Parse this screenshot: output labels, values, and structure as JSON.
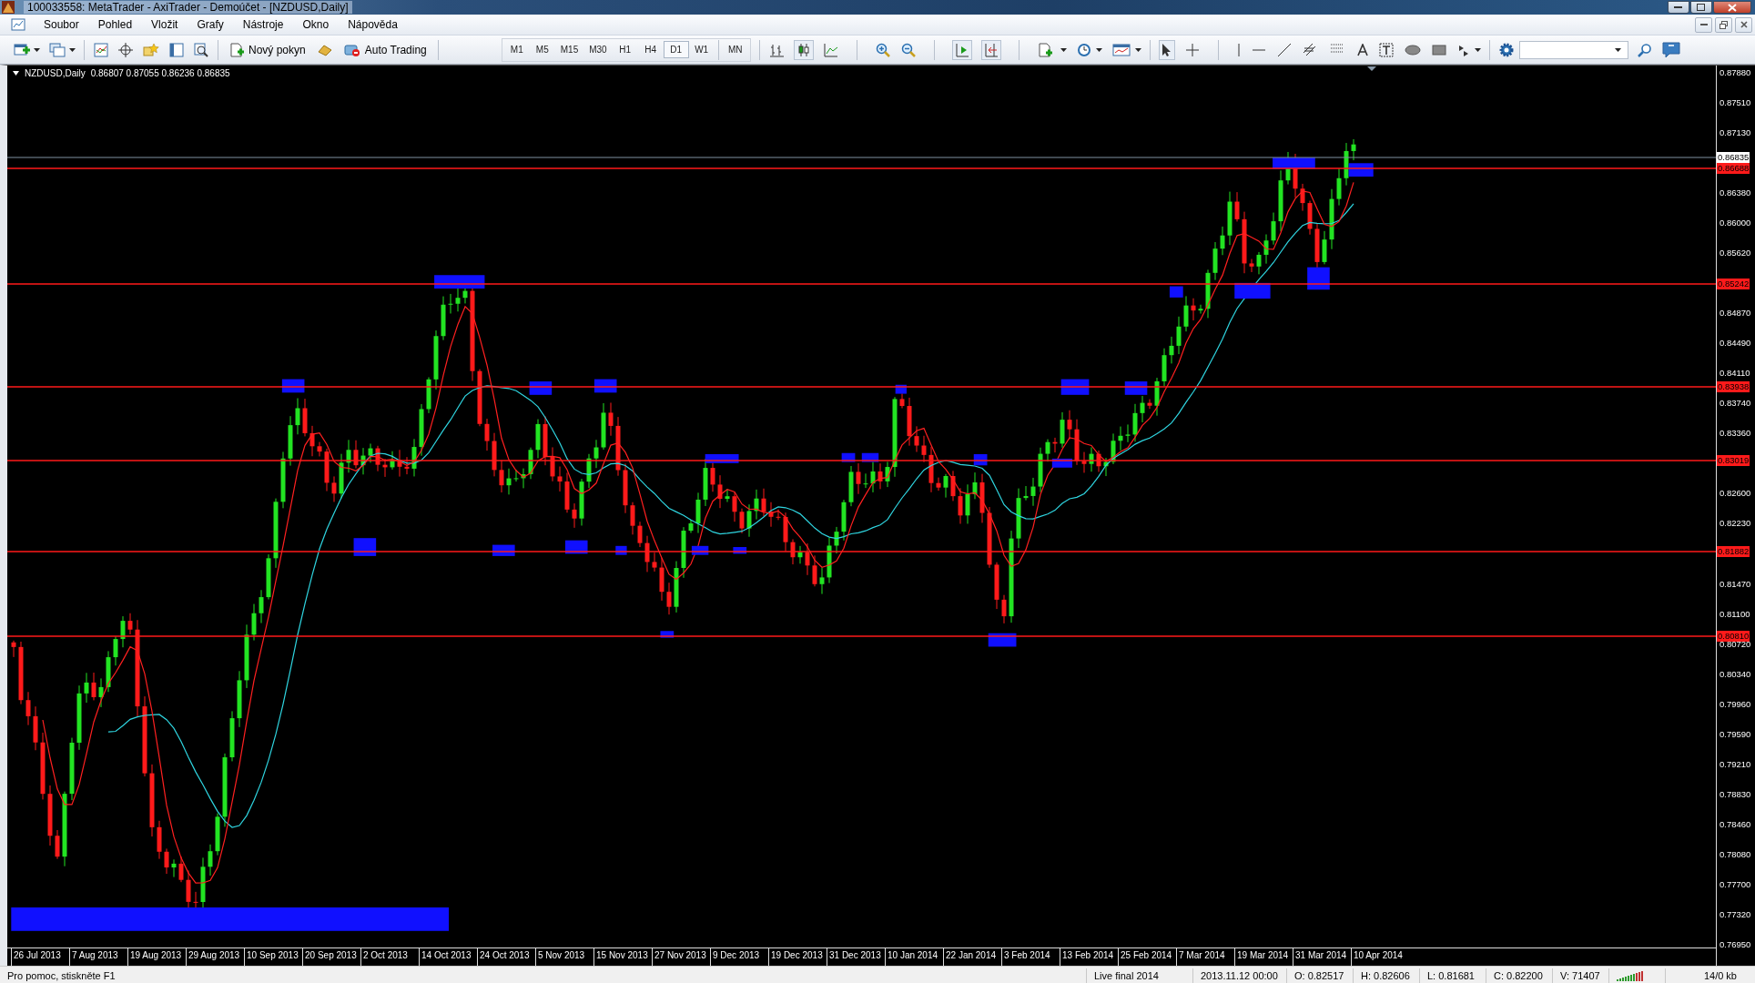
{
  "window": {
    "title": "100033558: MetaTrader - AxiTrader - Demoúčet - [NZDUSD,Daily]"
  },
  "menu": [
    "Soubor",
    "Pohled",
    "Vložit",
    "Grafy",
    "Nástroje",
    "Okno",
    "Nápověda"
  ],
  "toolbar": {
    "buttons": [
      {
        "kind": "order",
        "label": "Nový pokyn"
      },
      {
        "kind": "autotrading",
        "label": "Auto Trading"
      }
    ],
    "timeframes": [
      {
        "label": "M1",
        "selected": false
      },
      {
        "label": "M5",
        "selected": false
      },
      {
        "label": "M15",
        "selected": false
      },
      {
        "label": "M30",
        "selected": false
      },
      {
        "label": "H1",
        "selected": false
      },
      {
        "label": "H4",
        "selected": false
      },
      {
        "label": "D1",
        "selected": true
      },
      {
        "label": "W1",
        "selected": false
      },
      {
        "label": "MN",
        "selected": false
      }
    ]
  },
  "chart": {
    "symbol": "NZDUSD,Daily",
    "ohlc": "0.86807 0.87055 0.86236 0.86835",
    "price_ticks": [
      "0.87880",
      "0.87510",
      "0.87130",
      "0.86380",
      "0.86000",
      "0.85620",
      "0.84870",
      "0.84490",
      "0.84110",
      "0.83740",
      "0.83360",
      "0.82600",
      "0.82230",
      "0.81470",
      "0.81100",
      "0.80720",
      "0.80340",
      "0.79960",
      "0.79590",
      "0.79210",
      "0.78830",
      "0.78460",
      "0.78080",
      "0.77700",
      "0.77320",
      "0.76950"
    ],
    "current_price": "0.86835",
    "levels": [
      "0.86688",
      "0.85242",
      "0.83938",
      "0.83019",
      "0.81882",
      "0.80810"
    ],
    "dates": [
      "26 Jul 2013",
      "7 Aug 2013",
      "19 Aug 2013",
      "29 Aug 2013",
      "10 Sep 2013",
      "20 Sep 2013",
      "2 Oct 2013",
      "14 Oct 2013",
      "24 Oct 2013",
      "5 Nov 2013",
      "15 Nov 2013",
      "27 Nov 2013",
      "9 Dec 2013",
      "19 Dec 2013",
      "31 Dec 2013",
      "10 Jan 2014",
      "22 Jan 2014",
      "3 Feb 2014",
      "13 Feb 2014",
      "25 Feb 2014",
      "7 Mar 2014",
      "19 Mar 2014",
      "31 Mar 2014",
      "10 Apr 2014"
    ]
  },
  "status_bar": {
    "help": "Pro pomoc, stiskněte F1",
    "profile": "Live final 2014",
    "time": "2013.11.12 00:00",
    "open": "O: 0.82517",
    "high": "H: 0.82606",
    "low": "L: 0.81681",
    "close": "C: 0.82200",
    "volume": "V: 71407",
    "traffic": "14/0 kb"
  }
}
